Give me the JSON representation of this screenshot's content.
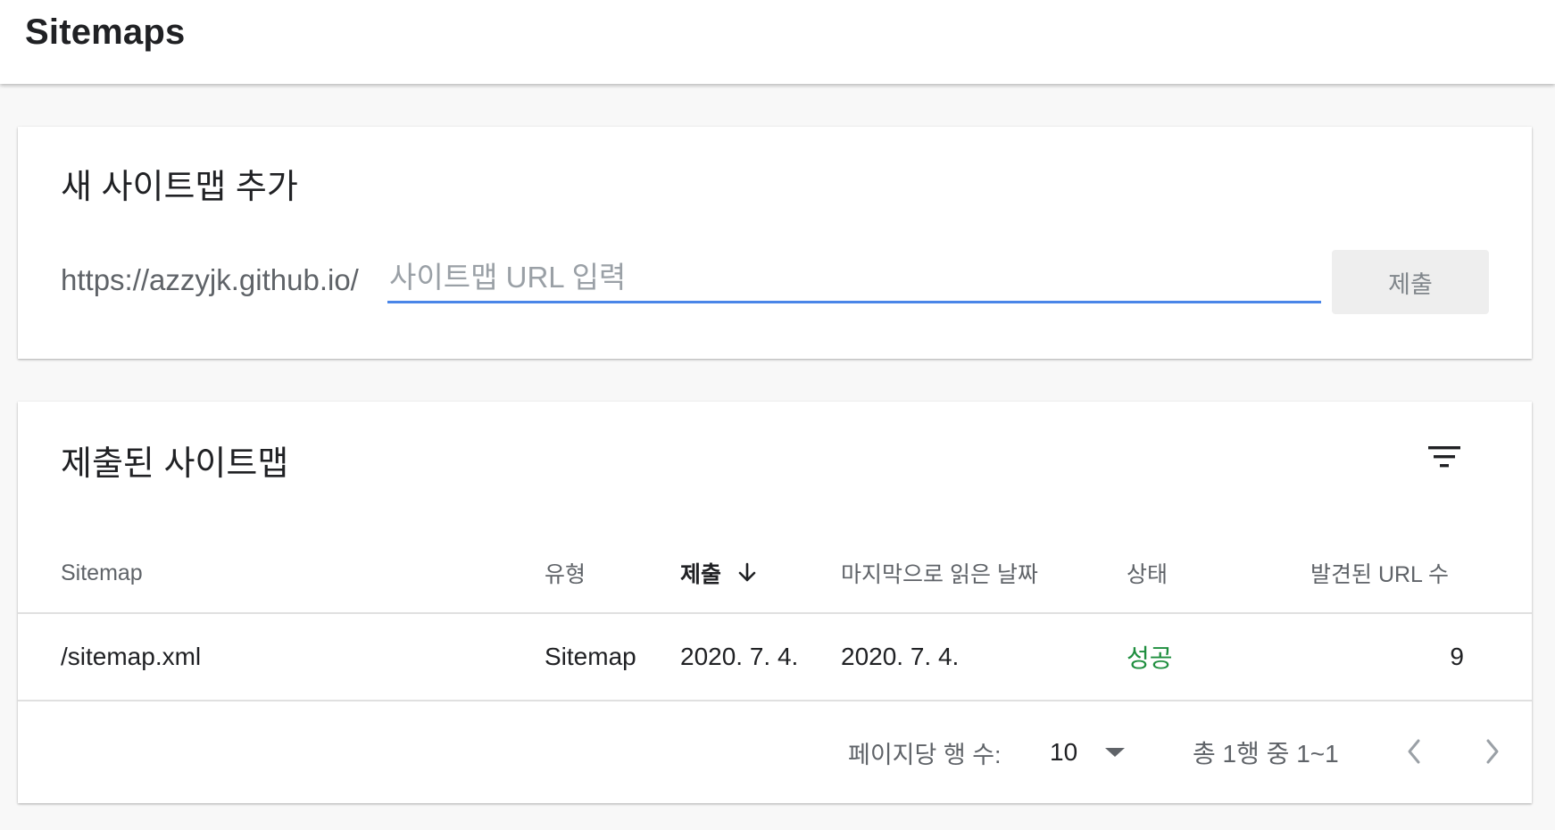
{
  "header": {
    "title": "Sitemaps"
  },
  "add_card": {
    "title": "새 사이트맵 추가",
    "url_prefix": "https://azzyjk.github.io/",
    "input_value": "",
    "input_placeholder": "사이트맵 URL 입력",
    "submit_label": "제출"
  },
  "list_card": {
    "title": "제출된 사이트맵",
    "filter_icon": "filter-list-icon",
    "columns": [
      {
        "label": "Sitemap"
      },
      {
        "label": "유형"
      },
      {
        "label": "제출",
        "sorted": "descending",
        "sort_icon": "arrow-down-icon"
      },
      {
        "label": "마지막으로 읽은 날짜"
      },
      {
        "label": "상태"
      },
      {
        "label": "발견된 URL 수"
      }
    ],
    "rows": [
      {
        "sitemap": "/sitemap.xml",
        "type": "Sitemap",
        "submitted": "2020. 7. 4.",
        "last_read": "2020. 7. 4.",
        "status": "성공",
        "discovered_urls": "9"
      }
    ],
    "pagination": {
      "rows_per_page_label": "페이지당 행 수:",
      "rows_per_page": "10",
      "range": "총 1행 중 1~1"
    }
  },
  "colors": {
    "accent_blue": "#4a86e8",
    "status_success": "#1e8e3e",
    "text_primary": "#202124",
    "text_secondary": "#5f6368"
  }
}
